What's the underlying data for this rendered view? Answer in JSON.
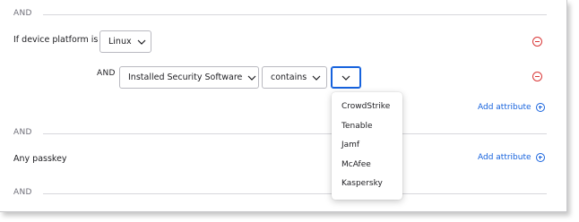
{
  "separators": [
    "AND",
    "AND",
    "AND"
  ],
  "rule1": {
    "label": "If device platform is",
    "platform_value": "Linux",
    "remove_icon": "minus-circle-icon"
  },
  "rule2": {
    "and_label": "AND",
    "attribute_value": "Installed Security Software",
    "operator_value": "contains",
    "value_select_value": "",
    "remove_icon": "minus-circle-icon"
  },
  "add_attribute_label": "Add attribute",
  "add_attribute_2_label": "Add attribute",
  "passkey_label": "Any passkey",
  "dropdown": {
    "options": [
      "CrowdStrike",
      "Tenable",
      "Jamf",
      "McAfee",
      "Kaspersky"
    ]
  },
  "colors": {
    "accent": "#1662dd",
    "danger": "#d93838",
    "muted": "#6e6e78"
  }
}
